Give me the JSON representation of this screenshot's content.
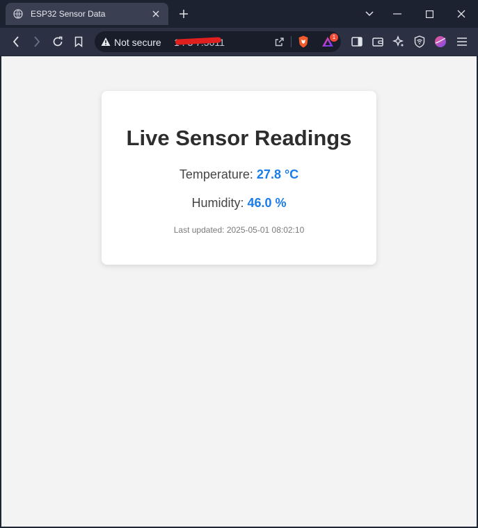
{
  "browser": {
    "tab": {
      "title": "ESP32 Sensor Data",
      "favicon": "globe-icon"
    },
    "address_bar": {
      "security_label": "Not secure",
      "url_visible": "1 . 3 7:5011",
      "url_redacted": true
    },
    "extension_badge_count": "1"
  },
  "page": {
    "heading": "Live Sensor Readings",
    "temperature": {
      "label": "Temperature:",
      "value": "27.8 °C"
    },
    "humidity": {
      "label": "Humidity:",
      "value": "46.0 %"
    },
    "last_updated": {
      "label": "Last updated:",
      "value": "2025-05-01 08:02:10"
    }
  },
  "colors": {
    "accent": "#1a7ce8",
    "card_bg": "#ffffff",
    "page_bg": "#f3f3f3",
    "chrome_bg": "#1c2230",
    "warning_red": "#e0201e"
  }
}
